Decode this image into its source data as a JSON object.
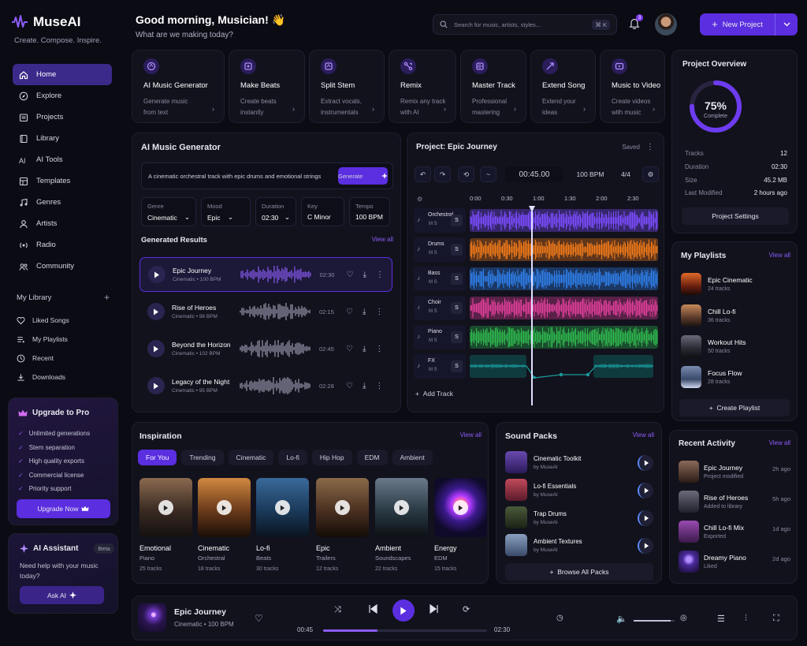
{
  "app": {
    "name": "MuseAI",
    "tagline": "Create. Compose. Inspire."
  },
  "nav": [
    {
      "label": "Home",
      "icon": "home-icon",
      "active": true
    },
    {
      "label": "Explore",
      "icon": "compass-icon"
    },
    {
      "label": "Projects",
      "icon": "folder-icon"
    },
    {
      "label": "Library",
      "icon": "library-icon"
    },
    {
      "label": "AI Tools",
      "icon": "sparkle-icon"
    },
    {
      "label": "Templates",
      "icon": "template-icon"
    },
    {
      "label": "Genres",
      "icon": "music-note-icon"
    },
    {
      "label": "Artists",
      "icon": "user-icon"
    },
    {
      "label": "Radio",
      "icon": "radio-icon"
    },
    {
      "label": "Community",
      "icon": "community-icon"
    }
  ],
  "library": {
    "title": "My Library",
    "items": [
      {
        "label": "Liked Songs",
        "icon": "heart-icon"
      },
      {
        "label": "My Playlists",
        "icon": "playlist-icon"
      },
      {
        "label": "Recent",
        "icon": "clock-icon"
      },
      {
        "label": "Downloads",
        "icon": "download-icon"
      }
    ]
  },
  "upgrade": {
    "title": "Upgrade to Pro",
    "features": [
      "Unlimited generations",
      "Stem separation",
      "High quality exports",
      "Commercial license",
      "Priority support"
    ],
    "button": "Upgrade Now"
  },
  "assistant": {
    "title": "AI Assistant",
    "badge": "Beta",
    "text": "Need help with your music today?",
    "button": "Ask AI"
  },
  "header": {
    "greeting": "Good morning, Musician! 👋",
    "subtitle": "What are we making today?",
    "search_placeholder": "Search for music, artists, styles...",
    "shortcut": "⌘ K",
    "notifications": "3",
    "new_project": "New Project"
  },
  "tools": [
    {
      "title": "AI Music Generator",
      "desc1": "Generate music",
      "desc2": "from text"
    },
    {
      "title": "Make Beats",
      "desc1": "Create beats",
      "desc2": "instantly"
    },
    {
      "title": "Split Stem",
      "desc1": "Extract vocals,",
      "desc2": "instrumentals"
    },
    {
      "title": "Remix",
      "desc1": "Remix any track",
      "desc2": "with AI"
    },
    {
      "title": "Master Track",
      "desc1": "Professional",
      "desc2": "mastering"
    },
    {
      "title": "Extend Song",
      "desc1": "Extend your",
      "desc2": "ideas"
    },
    {
      "title": "Music to Video",
      "desc1": "Create videos",
      "desc2": "with music"
    }
  ],
  "generator": {
    "title": "AI Music Generator",
    "prompt": "A cinematic orchestral track with epic drums and emotional strings",
    "generate": "Generate",
    "params": [
      {
        "label": "Genre",
        "value": "Cinematic",
        "dropdown": true
      },
      {
        "label": "Mood",
        "value": "Epic",
        "dropdown": true
      },
      {
        "label": "Duration",
        "value": "02:30",
        "dropdown": true
      },
      {
        "label": "Key",
        "value": "C Minor",
        "dropdown": false
      },
      {
        "label": "Tempo",
        "value": "100 BPM",
        "dropdown": false
      }
    ],
    "results_title": "Generated Results",
    "view_all": "View all",
    "results": [
      {
        "name": "Epic Journey",
        "meta": "Cinematic • 100 BPM",
        "dur": "02:30"
      },
      {
        "name": "Rise of Heroes",
        "meta": "Cinematic • 98 BPM",
        "dur": "02:15"
      },
      {
        "name": "Beyond the Horizon",
        "meta": "Cinematic • 102 BPM",
        "dur": "02:45"
      },
      {
        "name": "Legacy of the Night",
        "meta": "Cinematic • 95 BPM",
        "dur": "02:28"
      }
    ]
  },
  "project": {
    "title": "Project: Epic Journey",
    "status": "Saved",
    "time": "00:45.00",
    "bpm": "100 BPM",
    "signature": "4/4",
    "timeline": [
      "0:00",
      "0:30",
      "1:00",
      "1:30",
      "2:00",
      "2:30"
    ],
    "tracks": [
      {
        "name": "Orchestral",
        "ms": "M  S",
        "s": "S",
        "color": "#7c4dff"
      },
      {
        "name": "Drums",
        "ms": "M  S",
        "s": "S",
        "color": "#f07a1a"
      },
      {
        "name": "Bass",
        "ms": "M  S",
        "s": "S",
        "color": "#2f7fe8"
      },
      {
        "name": "Choir",
        "ms": "M  S",
        "s": "S",
        "color": "#e0409a"
      },
      {
        "name": "Piano",
        "ms": "M  S",
        "s": "S",
        "color": "#2fb84e"
      },
      {
        "name": "FX",
        "ms": "M  S",
        "s": "S",
        "color": "#1a9a9a"
      }
    ],
    "add_track": "Add Track"
  },
  "overview": {
    "title": "Project Overview",
    "percent": "75%",
    "percent_value": 0.75,
    "complete": "Complete",
    "rows": [
      {
        "k": "Tracks",
        "v": "12"
      },
      {
        "k": "Duration",
        "v": "02:30"
      },
      {
        "k": "Size",
        "v": "45.2 MB"
      },
      {
        "k": "Last Modified",
        "v": "2 hours ago"
      }
    ],
    "button": "Project Settings"
  },
  "playlists": {
    "title": "My Playlists",
    "view_all": "View all",
    "items": [
      {
        "name": "Epic Cinematic",
        "count": "24 tracks"
      },
      {
        "name": "Chill Lo-fi",
        "count": "36 tracks"
      },
      {
        "name": "Workout Hits",
        "count": "50 tracks"
      },
      {
        "name": "Focus Flow",
        "count": "28 tracks"
      }
    ],
    "create": "Create Playlist"
  },
  "inspiration": {
    "title": "Inspiration",
    "view_all": "View all",
    "filters": [
      "For You",
      "Trending",
      "Cinematic",
      "Lo-fi",
      "Hip Hop",
      "EDM",
      "Ambient"
    ],
    "cards": [
      {
        "name": "Emotional",
        "genre": "Piano",
        "tracks": "25 tracks"
      },
      {
        "name": "Cinematic",
        "genre": "Orchestral",
        "tracks": "18 tracks"
      },
      {
        "name": "Lo-fi",
        "genre": "Beats",
        "tracks": "30 tracks"
      },
      {
        "name": "Epic",
        "genre": "Trailers",
        "tracks": "12 tracks"
      },
      {
        "name": "Ambient",
        "genre": "Soundscapes",
        "tracks": "22 tracks"
      },
      {
        "name": "Energy",
        "genre": "EDM",
        "tracks": "15 tracks"
      }
    ]
  },
  "packs": {
    "title": "Sound Packs",
    "view_all": "View all",
    "items": [
      {
        "name": "Cinematic Toolkit",
        "by": "by MuseAI"
      },
      {
        "name": "Lo-fi Essentials",
        "by": "by MuseAI"
      },
      {
        "name": "Trap Drums",
        "by": "by MuseAI"
      },
      {
        "name": "Ambient Textures",
        "by": "by MuseAI"
      }
    ],
    "browse": "Browse All Packs"
  },
  "activity": {
    "title": "Recent Activity",
    "view_all": "View all",
    "items": [
      {
        "name": "Epic Journey",
        "sub": "Project modified",
        "time": "2h ago"
      },
      {
        "name": "Rise of Heroes",
        "sub": "Added to library",
        "time": "5h ago"
      },
      {
        "name": "Chill Lo-fi Mix",
        "sub": "Exported",
        "time": "1d ago"
      },
      {
        "name": "Dreamy Piano",
        "sub": "Liked",
        "time": "2d ago"
      }
    ]
  },
  "player": {
    "title": "Epic Journey",
    "sub": "Cinematic • 100 BPM",
    "current": "00:45",
    "total": "02:30",
    "progress": 0.33,
    "volume": 0.9
  }
}
